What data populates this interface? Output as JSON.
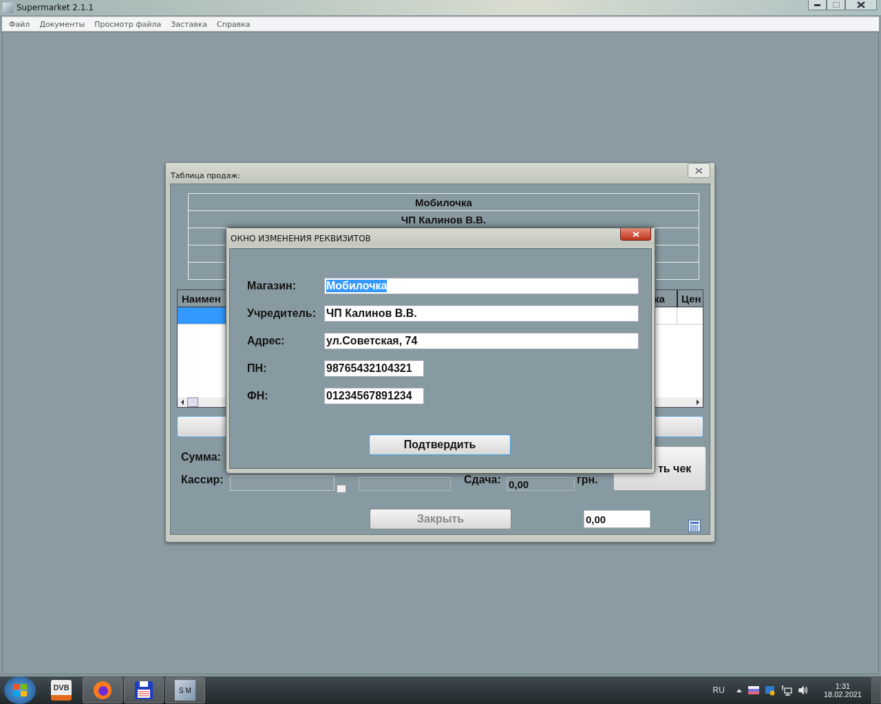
{
  "app_window": {
    "title": "Supermarket 2.1.1",
    "menu": [
      "Файл",
      "Документы",
      "Просмотр файла",
      "Заставка",
      "Справка"
    ]
  },
  "sales_window": {
    "title": "Таблица продаж:",
    "header_rows": [
      "Мобилочка",
      "ЧП Калинов В.В."
    ],
    "table": {
      "columns": [
        "Наимен",
        "ка",
        "Цен"
      ],
      "rows": [
        {
          "selected": true
        }
      ]
    },
    "sum_label": "Сумма:",
    "cashier_label": "Кассир:",
    "change_label": "Сдача:",
    "change_value": "0,00",
    "currency": "грн.",
    "check_button": "ть чек",
    "close_button": {
      "label": "Закрыть",
      "disabled": true
    },
    "total_field": "0,00"
  },
  "dialog": {
    "title": "ОКНО ИЗМЕНЕНИЯ РЕКВИЗИТОВ",
    "fields": [
      {
        "label": "Магазин:",
        "value": "Мобилочка",
        "kind": "wide",
        "selected": true
      },
      {
        "label": "Учредитель:",
        "value": "ЧП Калинов В.В.",
        "kind": "wide",
        "selected": false
      },
      {
        "label": "Адрес:",
        "value": "ул.Советская, 74",
        "kind": "wide",
        "selected": false
      },
      {
        "label": "ПН:",
        "value": "98765432104321",
        "kind": "short",
        "selected": false
      },
      {
        "label": "ФН:",
        "value": "01234567891234",
        "kind": "short",
        "selected": false
      }
    ],
    "confirm_button": "Подтвердить"
  },
  "taskbar": {
    "apps": [
      {
        "kind": "dvb",
        "label": "DVB"
      },
      {
        "kind": "firefox"
      },
      {
        "kind": "floppy"
      },
      {
        "kind": "sm",
        "label": "S M"
      }
    ],
    "language": "RU",
    "time": "1:31",
    "date": "18.02.2021"
  }
}
